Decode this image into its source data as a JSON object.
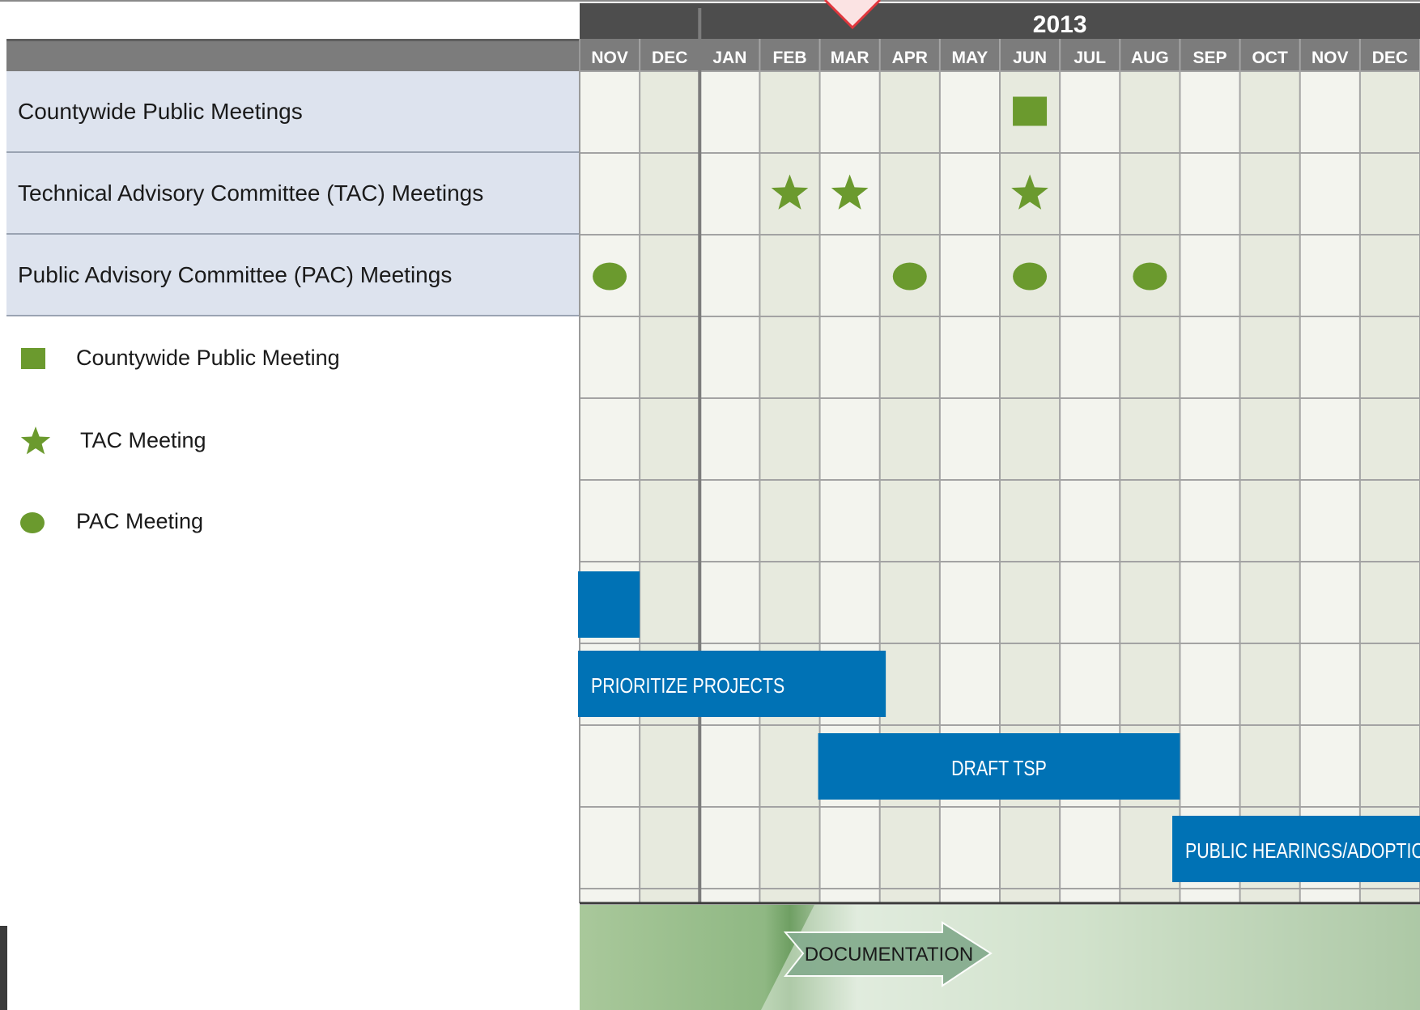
{
  "chart_data": {
    "type": "gantt",
    "year_label": "2013",
    "months": [
      "NOV",
      "DEC",
      "JAN",
      "FEB",
      "MAR",
      "APR",
      "MAY",
      "JUN",
      "JUL",
      "AUG",
      "SEP",
      "OCT",
      "NOV",
      "DEC"
    ],
    "meeting_rows": [
      {
        "label": "Countywide Public Meetings",
        "marker": "square",
        "months": [
          "JUN"
        ],
        "month_indexes": [
          7
        ]
      },
      {
        "label": "Technical Advisory Committee (TAC) Meetings",
        "marker": "star",
        "months": [
          "FEB",
          "MAR",
          "JUN"
        ],
        "month_indexes": [
          3,
          4,
          7
        ]
      },
      {
        "label": "Public Advisory Committee (PAC) Meetings",
        "marker": "circle",
        "months": [
          "NOV",
          "APR",
          "JUN",
          "AUG"
        ],
        "month_indexes": [
          0,
          5,
          7,
          9
        ]
      }
    ],
    "legend": [
      {
        "marker": "square",
        "label": "Countywide Public Meeting"
      },
      {
        "marker": "star",
        "label": "TAC Meeting"
      },
      {
        "marker": "circle",
        "label": "PAC Meeting"
      }
    ],
    "tasks": [
      {
        "label": "",
        "start": 0,
        "end": 1,
        "start_month": "NOV",
        "end_month": "NOV"
      },
      {
        "label": "PRIORITIZE PROJECTS",
        "start": 0,
        "end": 5.1,
        "start_month": "NOV",
        "end_month": "APR"
      },
      {
        "label": "DRAFT TSP",
        "start": 4,
        "end": 10,
        "start_month": "MAR",
        "end_month": "SEP"
      },
      {
        "label": "PUBLIC HEARINGS/ADOPTION",
        "start": 9.9,
        "end": 14,
        "start_month": "SEP",
        "end_month": "DEC"
      }
    ],
    "documentation_label": "DOCUMENTATION",
    "colors": {
      "marker_green": "#6b9a2e",
      "task_blue": "#0072b5",
      "header_dark": "#4d4d4d",
      "header_month": "#7c7c7c",
      "row_label_bg": "#dde3ee",
      "grid_light": "#f3f4ee",
      "grid_alt": "#e7eade",
      "doc_green": "#7fac72",
      "doc_arrow": "#86ad8f",
      "current_marker": "#e0363c"
    }
  }
}
